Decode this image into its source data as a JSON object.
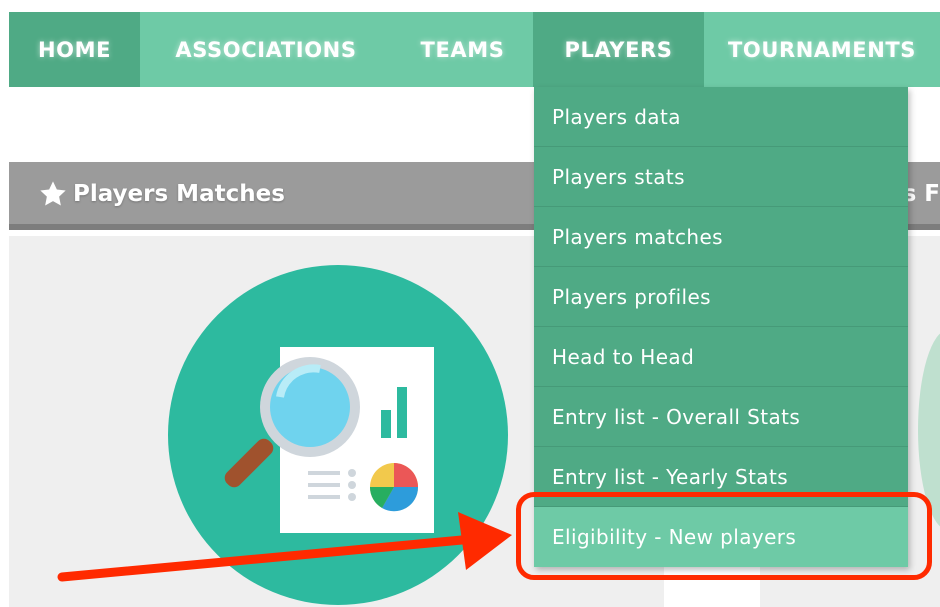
{
  "nav": {
    "items": [
      {
        "label": "HOME"
      },
      {
        "label": "ASSOCIATIONS"
      },
      {
        "label": "TEAMS"
      },
      {
        "label": "PLAYERS"
      },
      {
        "label": "TOURNAMENTS"
      }
    ]
  },
  "section": {
    "title": "Players Matches",
    "right_title_fragment": "s F"
  },
  "dropdown": {
    "items": [
      {
        "label": "Players data"
      },
      {
        "label": "Players stats"
      },
      {
        "label": "Players matches"
      },
      {
        "label": "Players profiles"
      },
      {
        "label": "Head to Head"
      },
      {
        "label": "Entry list - Overall Stats"
      },
      {
        "label": "Entry list - Yearly Stats"
      },
      {
        "label": "Eligibility - New players"
      }
    ]
  },
  "colors": {
    "nav_bg": "#6ecaa6",
    "nav_active": "#4faa85",
    "header_bg": "#9b9b9b",
    "illustration_circle": "#2dba9f",
    "annotation_red": "#ff2a00"
  },
  "icons": {
    "section_icon": "star-icon",
    "illustration": "magnifier-report-icon",
    "annotation": "red-arrow-icon"
  }
}
